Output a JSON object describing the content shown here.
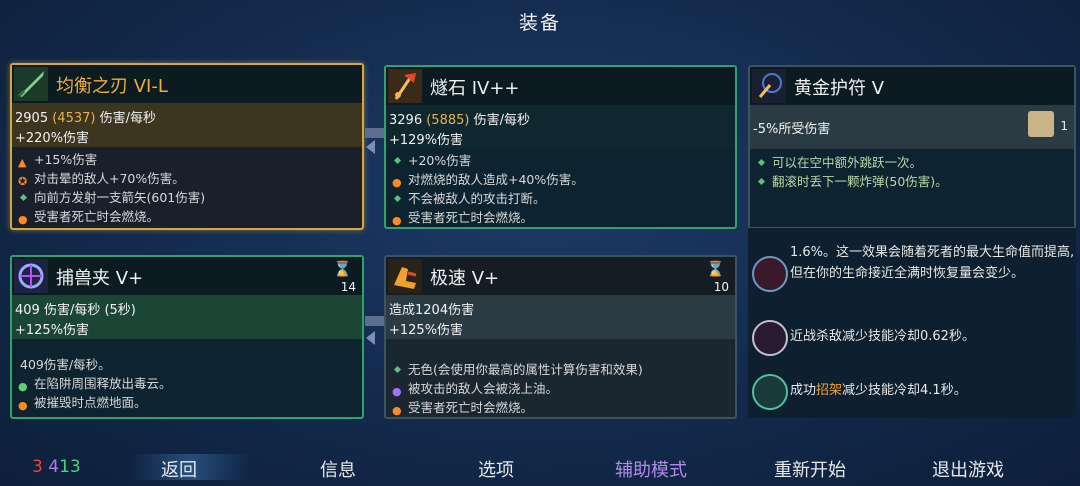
{
  "title": "装备",
  "cards": {
    "balanced_blade": {
      "name": "均衡之刃 VI-L",
      "dps_base": "2905",
      "dps_bonus": "(4537)",
      "dps_suffix": "伤害/每秒",
      "damage_pct": "+220%伤害",
      "effects": [
        "+15%伤害",
        "对击晕的敌人+70%伤害。",
        "向前方发射一支箭矢(601伤害)",
        "受害者死亡时会燃烧。"
      ]
    },
    "flint": {
      "name": "燧石 IV++",
      "dps_base": "3296",
      "dps_bonus": "(5885)",
      "dps_suffix": "伤害/每秒",
      "damage_pct": "+129%伤害",
      "effects": [
        "+20%伤害",
        "对燃烧的敌人造成+40%伤害。",
        "不会被敌人的攻击打断。",
        "受害者死亡时会燃烧。"
      ]
    },
    "amulet": {
      "name": "黄金护符 V",
      "stat": "-5%所受伤害",
      "scroll_count": "1",
      "effects": [
        "可以在空中额外跳跃一次。",
        "翻滚时丢下一颗炸弹(50伤害)。"
      ]
    },
    "trap": {
      "name": "捕兽夹 V+",
      "cooldown": "14",
      "dps": "409 伤害/每秒 (5秒)",
      "damage_pct": "+125%伤害",
      "effects": [
        "409伤害/每秒。",
        "在陷阱周围释放出毒云。",
        "被摧毁时点燃地面。"
      ]
    },
    "speed": {
      "name": "极速 V+",
      "cooldown": "10",
      "damage": "造成1204伤害",
      "damage_pct": "+125%伤害",
      "effects": [
        "无色(会使用你最高的属性计算伤害和效果)",
        "被攻击的敌人会被浇上油。",
        "受害者死亡时会燃烧。"
      ]
    }
  },
  "mutations": [
    {
      "text": "1.6%。这一效果会随着死者的最大生命值而提高,但在你的生命接近全满时恢复量会变少。"
    },
    {
      "text": "近战杀敌减少技能冷却0.62秒。"
    },
    {
      "text_pre": "成功",
      "text_hl": "招架",
      "text_post": "减少技能冷却4.1秒。"
    }
  ],
  "bottom": {
    "stat_red": "3",
    "stat_purple": "4",
    "stat_green": "13",
    "menu": [
      "返回",
      "信息",
      "选项",
      "辅助模式",
      "重新开始",
      "退出游戏"
    ]
  },
  "colors": {
    "gold_border": "#d9a63a",
    "green_border": "#2fa36e",
    "accent_purple": "#b18be8"
  }
}
